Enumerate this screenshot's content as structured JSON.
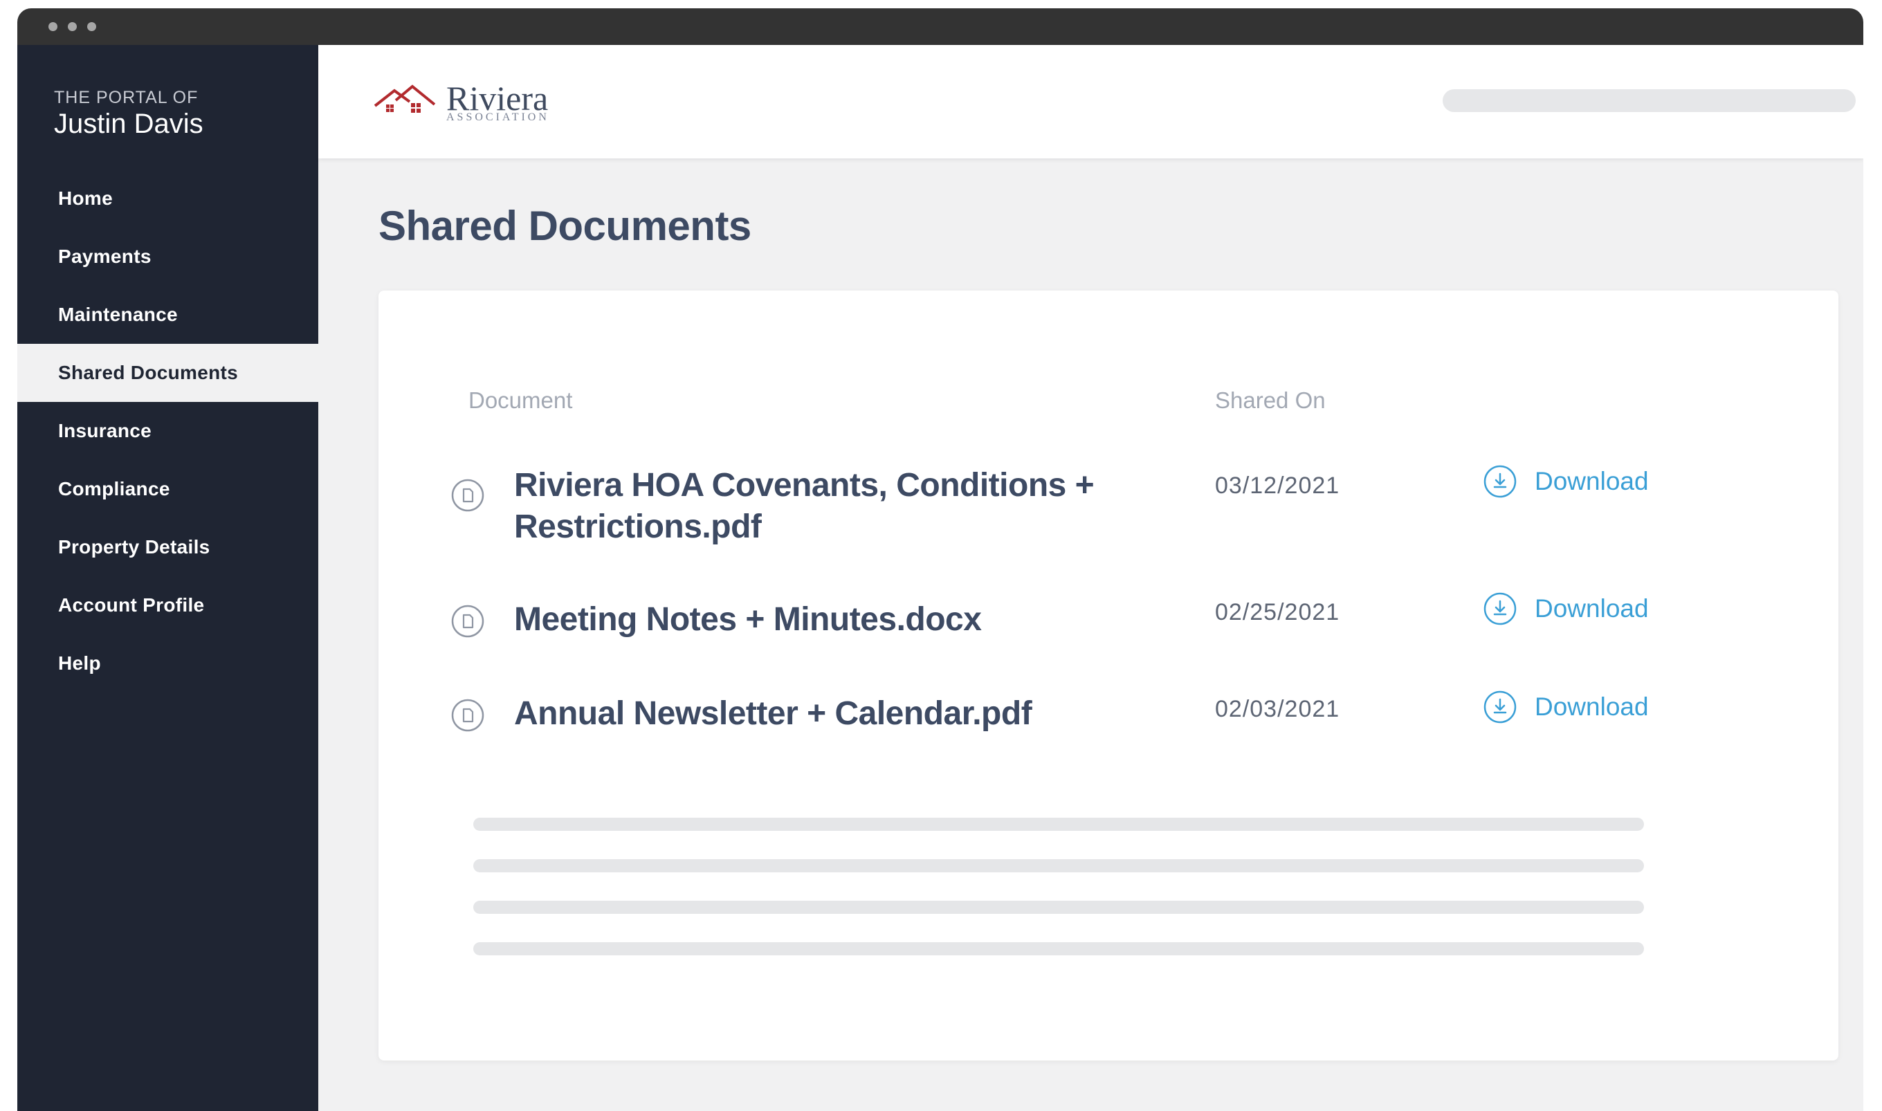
{
  "sidebar": {
    "portal_of": "THE PORTAL OF",
    "user_name": "Justin Davis",
    "items": [
      {
        "label": "Home"
      },
      {
        "label": "Payments"
      },
      {
        "label": "Maintenance"
      },
      {
        "label": "Shared Documents",
        "active": true
      },
      {
        "label": "Insurance"
      },
      {
        "label": "Compliance"
      },
      {
        "label": "Property Details"
      },
      {
        "label": "Account Profile"
      },
      {
        "label": "Help"
      }
    ]
  },
  "header": {
    "logo_main": "Riviera",
    "logo_sub": "ASSOCIATION",
    "brand_color": "#b22a2e"
  },
  "main": {
    "title": "Shared Documents",
    "table": {
      "columns": [
        "Document",
        "Shared On"
      ],
      "rows": [
        {
          "name_line1": "Riviera HOA Covenants, Conditions +",
          "name_line2": "Restrictions.pdf",
          "date": "03/12/2021",
          "action": "Download",
          "icon": "document-icon"
        },
        {
          "name_line1": "Meeting Notes + Minutes.docx",
          "name_line2": "",
          "date": "02/25/2021",
          "action": "Download",
          "icon": "document-icon"
        },
        {
          "name_line1": "Annual Newsletter + Calendar.pdf",
          "name_line2": "",
          "date": "02/03/2021",
          "action": "Download",
          "icon": "document-icon"
        }
      ]
    },
    "accent_color": "#3a9fd6"
  }
}
